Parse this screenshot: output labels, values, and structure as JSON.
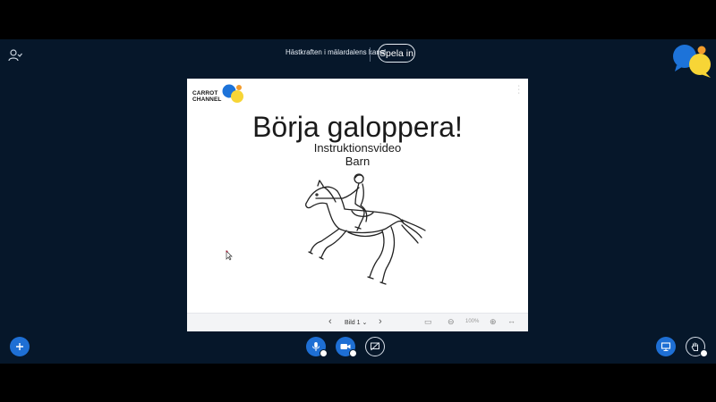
{
  "header": {
    "title": "Hästkraften i mälardalens kanal",
    "record_label": "Spela in"
  },
  "slide": {
    "logo_line1": "CARROT",
    "logo_line2": "CHANNEL",
    "title": "Börja galoppera!",
    "subtitle1": "Instruktionsvideo",
    "subtitle2": "Barn",
    "current_slide": "Bild 1",
    "zoom": "100%"
  },
  "colors": {
    "background": "#06172a",
    "accent": "#1e6fd4",
    "logo_blue": "#1d73d9",
    "logo_orange": "#f39c2c",
    "logo_yellow": "#f7d536"
  },
  "icons": [
    "user-icon",
    "chevron-left-icon",
    "chevron-right-icon",
    "plus-icon",
    "microphone-icon",
    "camera-icon",
    "screen-share-icon",
    "presentation-icon",
    "raise-hand-icon"
  ]
}
